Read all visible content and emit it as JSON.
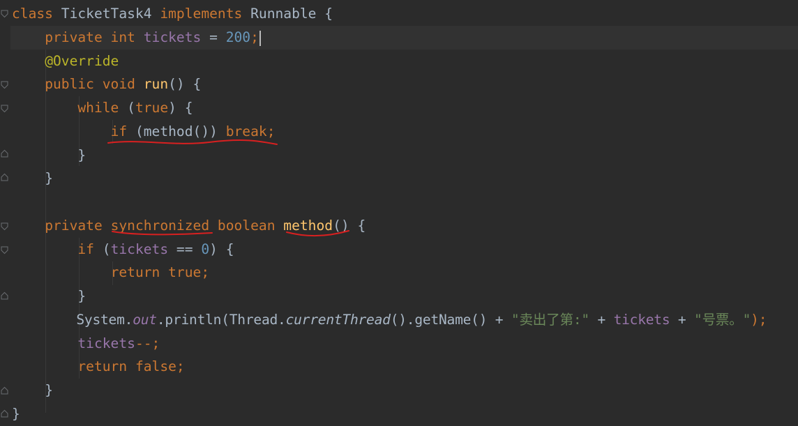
{
  "editor": {
    "lines": [
      [
        "class",
        " TicketTask4 ",
        "implements",
        " Runnable {"
      ],
      [
        "private int",
        " ",
        "tickets",
        " = ",
        "200",
        ";"
      ],
      [
        "@Override"
      ],
      [
        "public void",
        " ",
        "run",
        "() {"
      ],
      [
        "while",
        " (",
        "true",
        ") {"
      ],
      [
        "if",
        " (method()) ",
        "break;"
      ],
      [
        "}"
      ],
      [
        "}"
      ],
      [],
      [
        "private",
        " ",
        "synchronized",
        " ",
        "boolean",
        " ",
        "method",
        "() {"
      ],
      [
        "if",
        " (",
        "tickets",
        " == ",
        "0",
        ") {"
      ],
      [
        "return true;"
      ],
      [
        "}"
      ],
      [
        "System.",
        "out",
        ".println(Thread.",
        "currentThread",
        "().getName() + ",
        "\"卖出了第:\"",
        " + ",
        "tickets",
        " + ",
        "\"号票。\"",
        ");"
      ],
      [
        "tickets",
        "--;"
      ],
      [
        "return false;"
      ],
      [
        "}"
      ],
      [
        "}"
      ]
    ]
  },
  "colors": {
    "background": "#2b2b2b",
    "current_line": "#323232",
    "keyword": "#cc7832",
    "field": "#9876aa",
    "number": "#6897bb",
    "annotation": "#bbb529",
    "method": "#ffc66d",
    "string": "#6a8759",
    "text": "#a9b7c6",
    "underline": "#d92020"
  }
}
